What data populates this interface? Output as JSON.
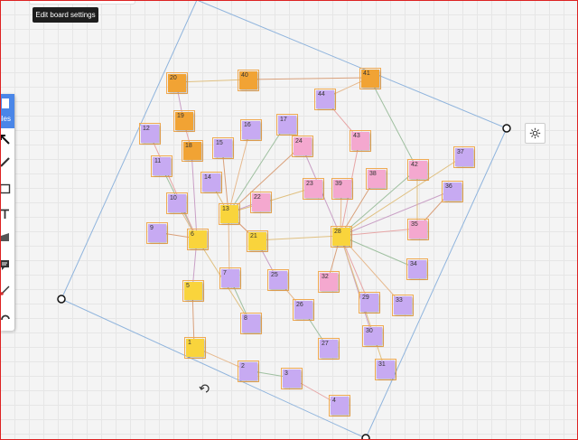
{
  "tooltip": {
    "text": "Edit board settings"
  },
  "toolbar": {
    "files_label": "iles",
    "tools": [
      "select-arrow-icon",
      "pen-icon",
      "rectangle-icon",
      "text-icon",
      "highlighter-icon",
      "sticky-note-icon",
      "connector-icon",
      "undo-icon"
    ]
  },
  "notes": [
    {
      "id": "1",
      "color": "yellow"
    },
    {
      "id": "2",
      "color": "purple"
    },
    {
      "id": "3",
      "color": "purple"
    },
    {
      "id": "4",
      "color": "purple"
    },
    {
      "id": "5",
      "color": "yellow"
    },
    {
      "id": "6",
      "color": "yellow"
    },
    {
      "id": "7",
      "color": "purple"
    },
    {
      "id": "8",
      "color": "purple"
    },
    {
      "id": "9",
      "color": "purple"
    },
    {
      "id": "10",
      "color": "purple"
    },
    {
      "id": "11",
      "color": "purple"
    },
    {
      "id": "12",
      "color": "purple"
    },
    {
      "id": "13",
      "color": "yellow"
    },
    {
      "id": "14",
      "color": "purple"
    },
    {
      "id": "15",
      "color": "purple"
    },
    {
      "id": "16",
      "color": "purple"
    },
    {
      "id": "17",
      "color": "purple"
    },
    {
      "id": "18",
      "color": "orange"
    },
    {
      "id": "19",
      "color": "orange"
    },
    {
      "id": "20",
      "color": "orange"
    },
    {
      "id": "21",
      "color": "yellow"
    },
    {
      "id": "22",
      "color": "pink"
    },
    {
      "id": "23",
      "color": "pink"
    },
    {
      "id": "24",
      "color": "pink"
    },
    {
      "id": "25",
      "color": "purple"
    },
    {
      "id": "26",
      "color": "purple"
    },
    {
      "id": "27",
      "color": "purple"
    },
    {
      "id": "28",
      "color": "yellow"
    },
    {
      "id": "29",
      "color": "purple"
    },
    {
      "id": "30",
      "color": "purple"
    },
    {
      "id": "31",
      "color": "purple"
    },
    {
      "id": "32",
      "color": "pink"
    },
    {
      "id": "33",
      "color": "purple"
    },
    {
      "id": "34",
      "color": "purple"
    },
    {
      "id": "35",
      "color": "pink"
    },
    {
      "id": "36",
      "color": "purple"
    },
    {
      "id": "37",
      "color": "purple"
    },
    {
      "id": "38",
      "color": "pink"
    },
    {
      "id": "39",
      "color": "pink"
    },
    {
      "id": "40",
      "color": "orange"
    },
    {
      "id": "41",
      "color": "orange"
    },
    {
      "id": "42",
      "color": "pink"
    },
    {
      "id": "43",
      "color": "pink"
    },
    {
      "id": "44",
      "color": "purple"
    }
  ],
  "links": [
    [
      "1",
      "5"
    ],
    [
      "1",
      "2"
    ],
    [
      "2",
      "3"
    ],
    [
      "3",
      "4"
    ],
    [
      "5",
      "6"
    ],
    [
      "6",
      "8"
    ],
    [
      "6",
      "9"
    ],
    [
      "6",
      "10"
    ],
    [
      "6",
      "11"
    ],
    [
      "6",
      "12"
    ],
    [
      "6",
      "18"
    ],
    [
      "13",
      "14"
    ],
    [
      "13",
      "15"
    ],
    [
      "13",
      "16"
    ],
    [
      "13",
      "17"
    ],
    [
      "13",
      "21"
    ],
    [
      "13",
      "22"
    ],
    [
      "13",
      "23"
    ],
    [
      "13",
      "24"
    ],
    [
      "13",
      "7"
    ],
    [
      "7",
      "8"
    ],
    [
      "18",
      "19"
    ],
    [
      "19",
      "20"
    ],
    [
      "20",
      "40"
    ],
    [
      "40",
      "41"
    ],
    [
      "41",
      "44"
    ],
    [
      "41",
      "42"
    ],
    [
      "44",
      "43"
    ],
    [
      "21",
      "25"
    ],
    [
      "21",
      "28"
    ],
    [
      "21",
      "13"
    ],
    [
      "25",
      "26"
    ],
    [
      "26",
      "27"
    ],
    [
      "28",
      "29"
    ],
    [
      "28",
      "30"
    ],
    [
      "28",
      "31"
    ],
    [
      "28",
      "32"
    ],
    [
      "28",
      "33"
    ],
    [
      "28",
      "34"
    ],
    [
      "28",
      "35"
    ],
    [
      "28",
      "36"
    ],
    [
      "28",
      "37"
    ],
    [
      "28",
      "38"
    ],
    [
      "28",
      "39"
    ],
    [
      "28",
      "42"
    ],
    [
      "28",
      "43"
    ],
    [
      "28",
      "24"
    ],
    [
      "42",
      "35"
    ],
    [
      "36",
      "35"
    ]
  ],
  "colors": {
    "accent": "#4a86e8",
    "border": "#d22",
    "selection": "#8fb4dd"
  }
}
